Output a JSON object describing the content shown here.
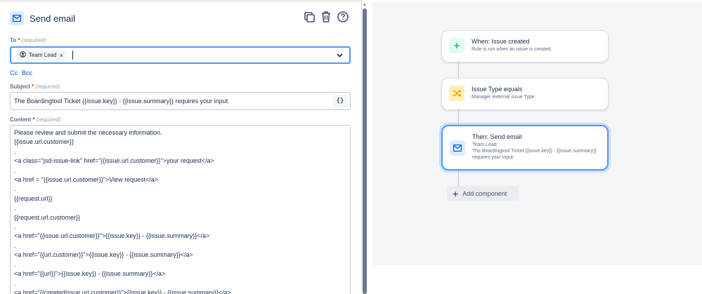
{
  "header": {
    "title": "Send email"
  },
  "to": {
    "label": "To",
    "required_mark": "*",
    "required_note": "(required)",
    "chip_label": "Team Lead",
    "chip_remove": "×"
  },
  "cc_bcc": {
    "cc": "Cc",
    "bcc": "Bcc"
  },
  "subject": {
    "label": "Subject",
    "required_mark": "*",
    "required_note": "(required)",
    "value": "The Boardingtool Ticket {{issue.key}} - {{issue.summary}} requires your input.",
    "smart_values_button": "{}"
  },
  "content": {
    "label": "Content",
    "required_mark": "*",
    "required_note": "(required)",
    "lines": [
      "Please review and submit the necessary information.",
      "{{issue.url.customer}}",
      ".",
      "<a class=\"jsd-issue-link\" href=\"{{issue.url.customer}}\">your request</a>",
      ".",
      "<a href = \"{{issue.url.customer}}\">View request</a>",
      ".",
      "{{request.url}}",
      ".",
      "{{request.url.customer}}",
      ".",
      "<a href=\"{{issue.url.customer}}\">{{issue.key}} - {{issue.summary}}</a>",
      ".",
      "<a href=\"{{url.customer}}\">{{issue.key}} - {{issue.summary}}</a>",
      ".",
      "<a href=\"{{url}}\">{{issue.key}} - {{issue.summary}}</a>",
      ".",
      "<a href=\"{{createdIssue.url.customer}}\">{{issue.key}} - {{issue.summary}}</a>"
    ]
  },
  "flow": {
    "nodes": [
      {
        "title": "When: Issue created",
        "subtitle": "Rule is run when an issue is created.",
        "icon": "plus-icon",
        "color": "#36b37e"
      },
      {
        "title": "Issue Type equals",
        "subtitle": "Manager external issue Type",
        "icon": "shuffle-icon",
        "color": "#ffab00"
      },
      {
        "title": "Then: Send email",
        "subtitle_line1": "Team Lead",
        "subtitle_line2": "The Boardingtool Ticket {{issue.key}} - {{issue.summary}}",
        "subtitle_line3": "requires your input.",
        "icon": "mail-icon",
        "color": "#0052cc"
      }
    ],
    "add_component_label": "Add component"
  },
  "colors": {
    "accent": "#4c9aff",
    "link": "#0052cc",
    "canvas_bg": "#f4f5f7"
  }
}
